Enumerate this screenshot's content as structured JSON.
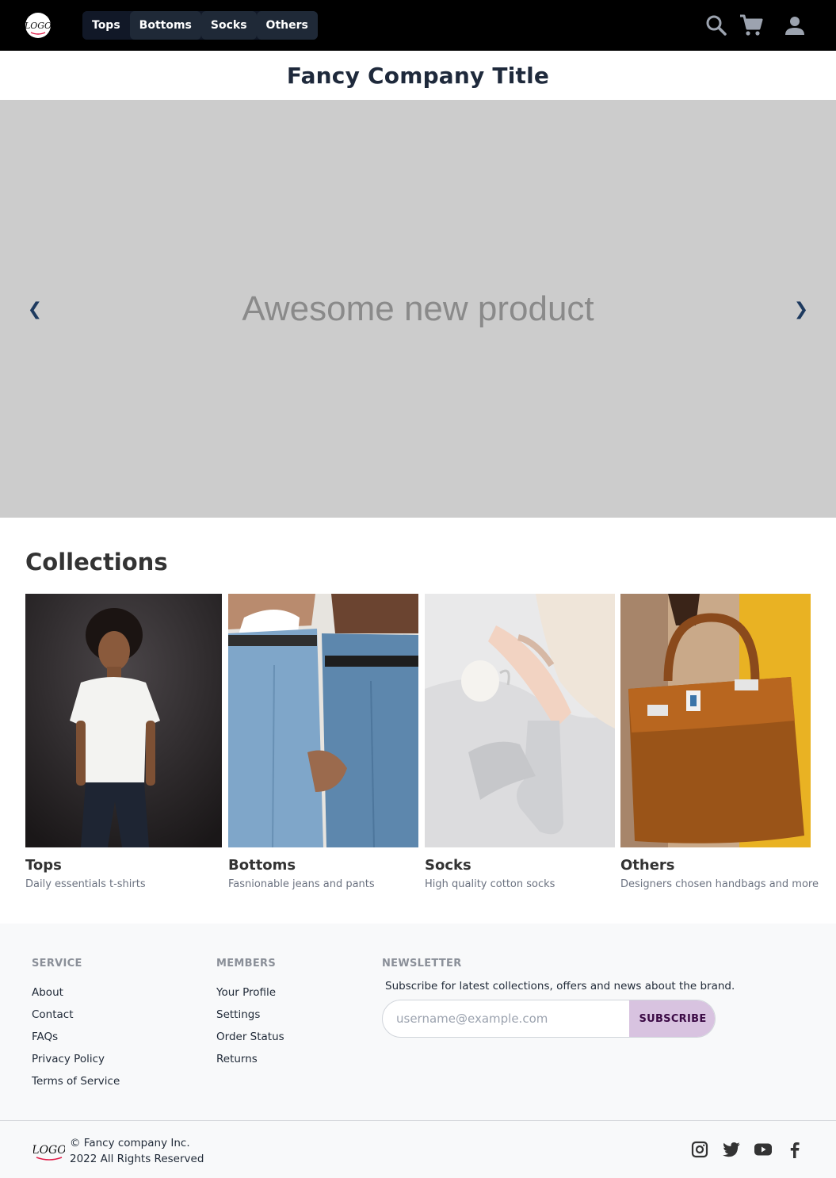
{
  "header": {
    "logo_text": "LOGO",
    "nav": [
      "Tops",
      "Bottoms",
      "Socks",
      "Others"
    ],
    "icons": [
      "search-icon",
      "cart-icon",
      "account-icon"
    ]
  },
  "title": "Fancy Company Title",
  "hero": {
    "text": "Awesome new product",
    "prev_label": "❮",
    "next_label": "❯"
  },
  "collections": {
    "heading": "Collections",
    "items": [
      {
        "name": "Tops",
        "desc": "Daily essentials t-shirts"
      },
      {
        "name": "Bottoms",
        "desc": "Fasnionable jeans and pants"
      },
      {
        "name": "Socks",
        "desc": "High quality cotton socks"
      },
      {
        "name": "Others",
        "desc": "Designers chosen handbags and more"
      }
    ]
  },
  "footer": {
    "service": {
      "heading": "SERVICE",
      "links": [
        "About",
        "Contact",
        "FAQs",
        "Privacy Policy",
        "Terms of Service"
      ]
    },
    "members": {
      "heading": "MEMBERS",
      "links": [
        "Your Profile",
        "Settings",
        "Order Status",
        "Returns"
      ]
    },
    "newsletter": {
      "heading": "NEWSLETTER",
      "note": "Subscribe for latest collections, offers and news about the brand.",
      "placeholder": "username@example.com",
      "button": "SUBSCRIBE"
    },
    "copyright_line1": "© Fancy company Inc.",
    "copyright_line2": "2022 All Rights Reserved",
    "social": [
      "instagram-icon",
      "twitter-icon",
      "youtube-icon",
      "facebook-icon"
    ]
  },
  "colors": {
    "topbar": "#000000",
    "nav_button": "#111827",
    "hero_bg": "#cccccc",
    "footer_bg": "#f8f9fa",
    "subscribe_button": "#d8c3e0"
  }
}
